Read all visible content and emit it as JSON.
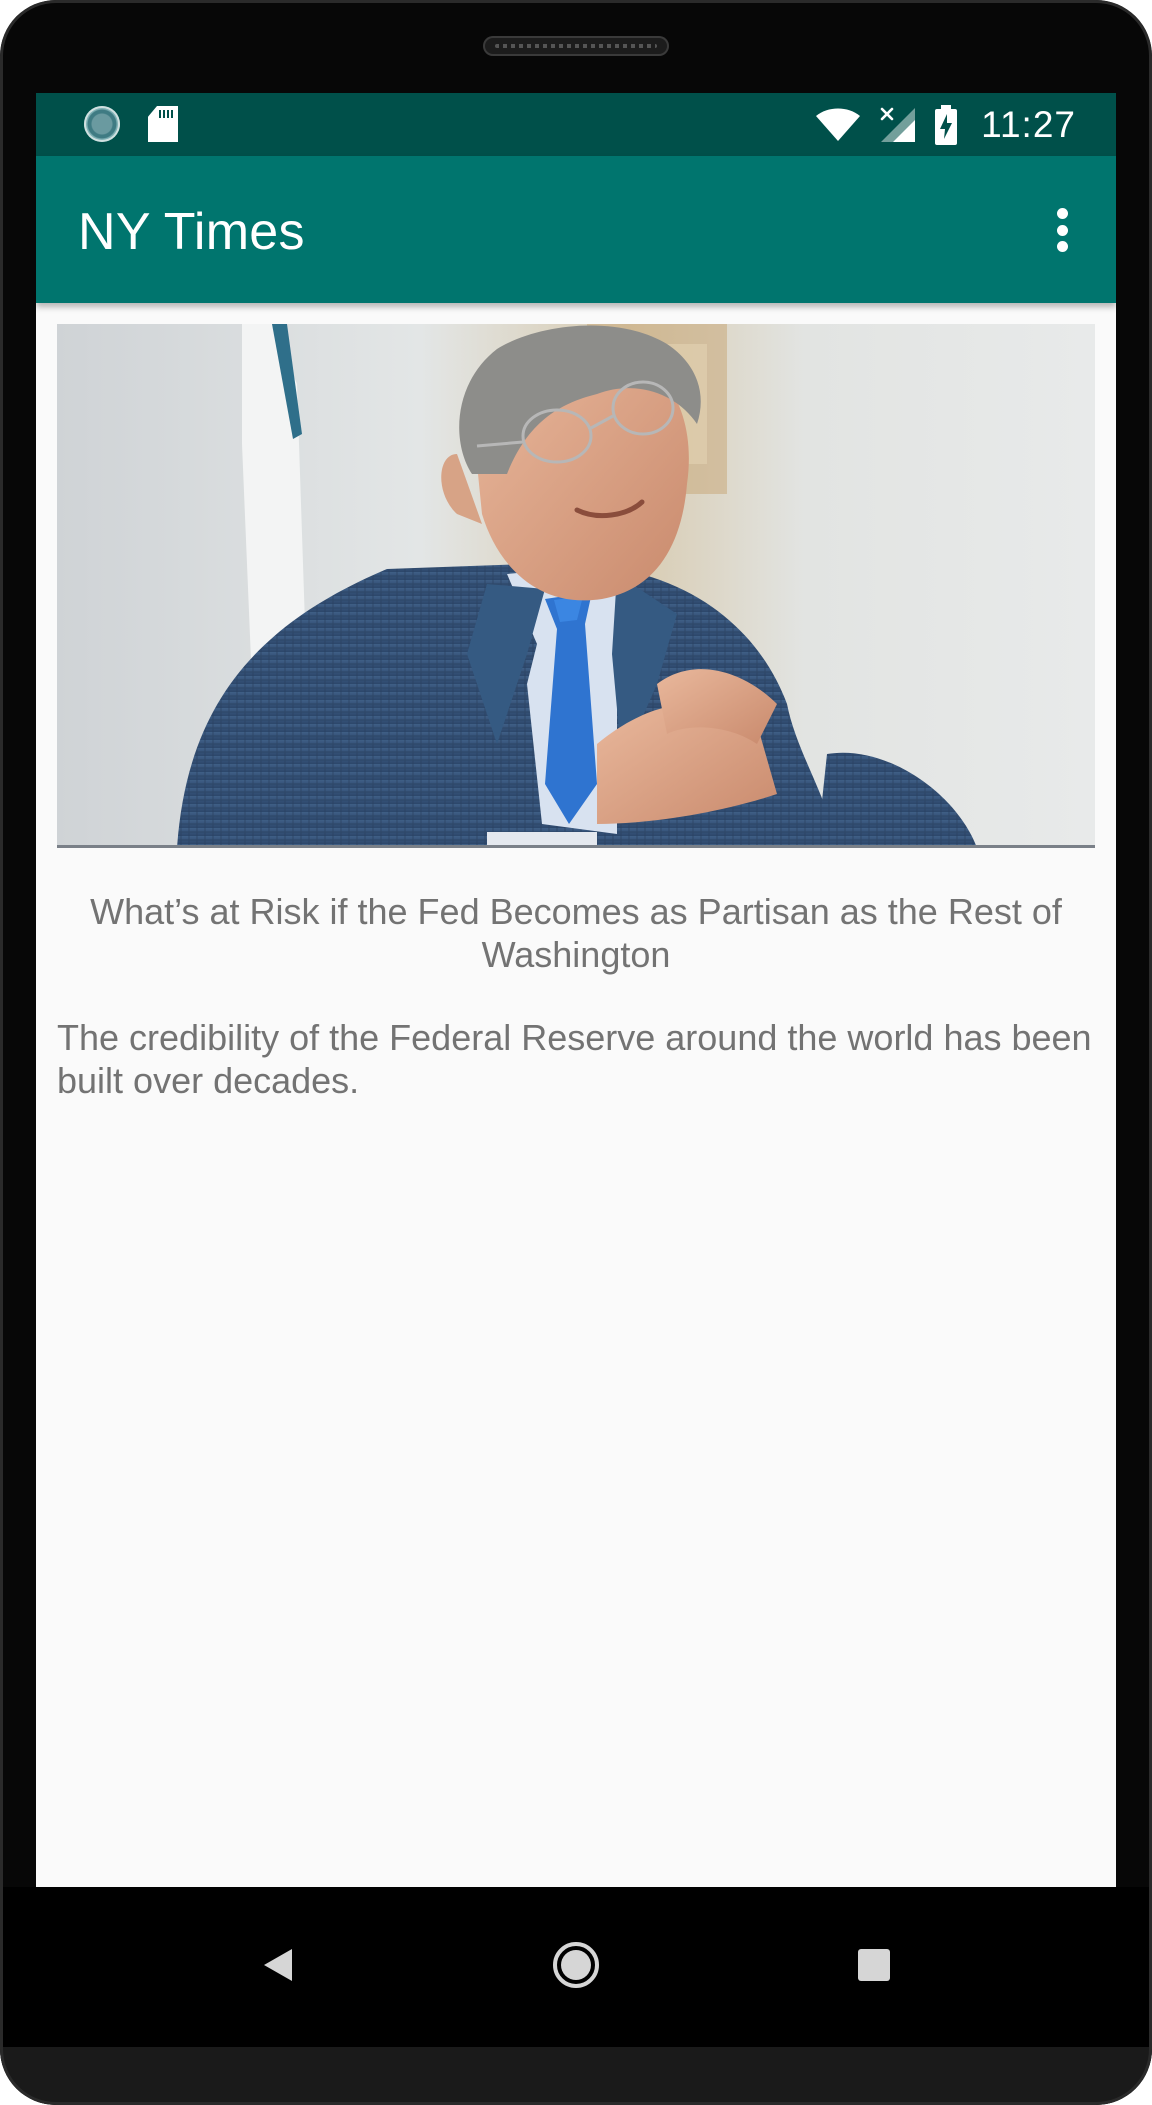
{
  "status_bar": {
    "time": "11:27",
    "icons": [
      "sync-icon",
      "sd-card-icon",
      "wifi-icon",
      "cellular-no-signal-icon",
      "battery-charging-icon"
    ]
  },
  "app_bar": {
    "title": "NY Times",
    "overflow_icon": "more-vert-icon"
  },
  "article": {
    "image_description_icon": "article-photo",
    "headline": "What’s at Risk if the Fed Becomes as Partisan as the Rest of Washington",
    "abstract": "The credibility of the Federal Reserve around the world has been built over decades."
  },
  "nav_bar": {
    "buttons": [
      "back-icon",
      "home-icon",
      "recents-icon"
    ]
  },
  "colors": {
    "status_bar": "#00504a",
    "app_bar": "#00756e",
    "background": "#fafafa",
    "text": "#737373"
  }
}
